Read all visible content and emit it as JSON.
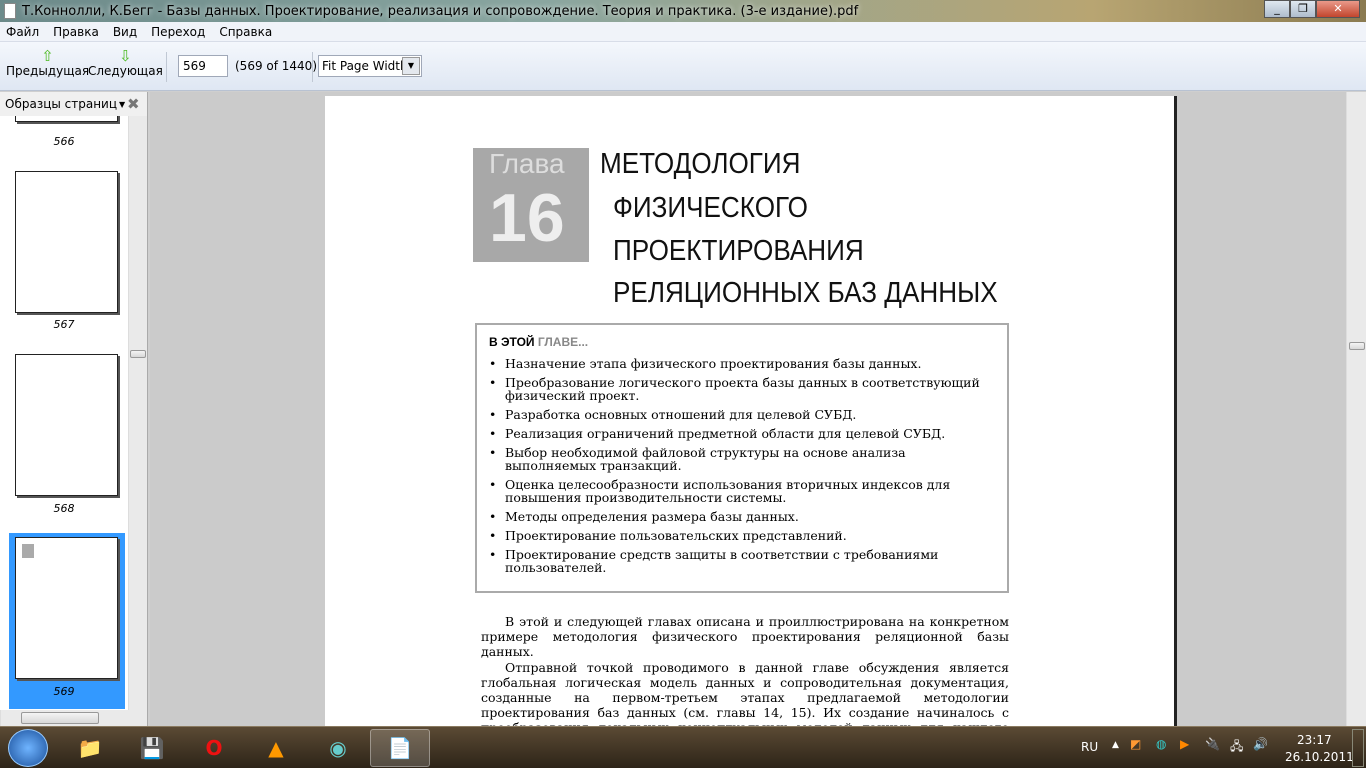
{
  "window": {
    "title": "Т.Коннолли, К.Бегг - Базы данных. Проектирование, реализация и сопровождение. Теория и практика. (3-е издание).pdf"
  },
  "menu": [
    "Файл",
    "Правка",
    "Вид",
    "Переход",
    "Справка"
  ],
  "toolbar": {
    "prev": "Предыдущая",
    "next": "Следующая",
    "page": "569",
    "page_count": "(569 of 1440)",
    "zoom": "Fit Page Width"
  },
  "sidebar": {
    "title": "Образцы страниц",
    "pages": [
      "566",
      "567",
      "568",
      "569"
    ]
  },
  "page": {
    "chapter_word": "Глава",
    "chapter_num": "16",
    "title_lines": [
      "МЕТОДОЛОГИЯ",
      "ФИЗИЧЕСКОГО",
      "ПРОЕКТИРОВАНИЯ",
      "РЕЛЯЦИОННЫХ БАЗ ДАННЫХ"
    ],
    "box_head_a": "В ЭТОЙ",
    "box_head_b": "ГЛАВЕ...",
    "items": [
      "Назначение этапа физического проектирования базы данных.",
      "Преобразование логического проекта базы данных в соответствующий физический проект.",
      "Разработка основных отношений для целевой СУБД.",
      "Реализация ограничений предметной области для целевой СУБД.",
      "Выбор необходимой файловой структуры на основе анализа выполняемых транзакций.",
      "Оценка целесообразности использования вторичных индексов для повышения производительности системы.",
      "Методы определения размера базы данных.",
      "Проектирование пользовательских представлений.",
      "Проектирование средств защиты в соответствии с требованиями пользователей."
    ],
    "para1": "В этой и следующей главах описана и проиллюстрирована на конкретном примере методология физического проектирования реляционной базы данных.",
    "para2": "Отправной точкой проводимого в данной главе обсуждения является глобальная логическая модель данных и сопроводительная документация, созданные на первом-третьем этапах предлагаемой методологии проектирования баз данных (см. главы 14, 15). Их создание начиналось с преобразования локальных концептуальных моделей данных для каждого представления на этапе 1 и подготовки локальных логических моделей данных для каждого представления на этапе"
  },
  "tray": {
    "lang": "RU",
    "time": "23:17",
    "date": "26.10.2011"
  }
}
